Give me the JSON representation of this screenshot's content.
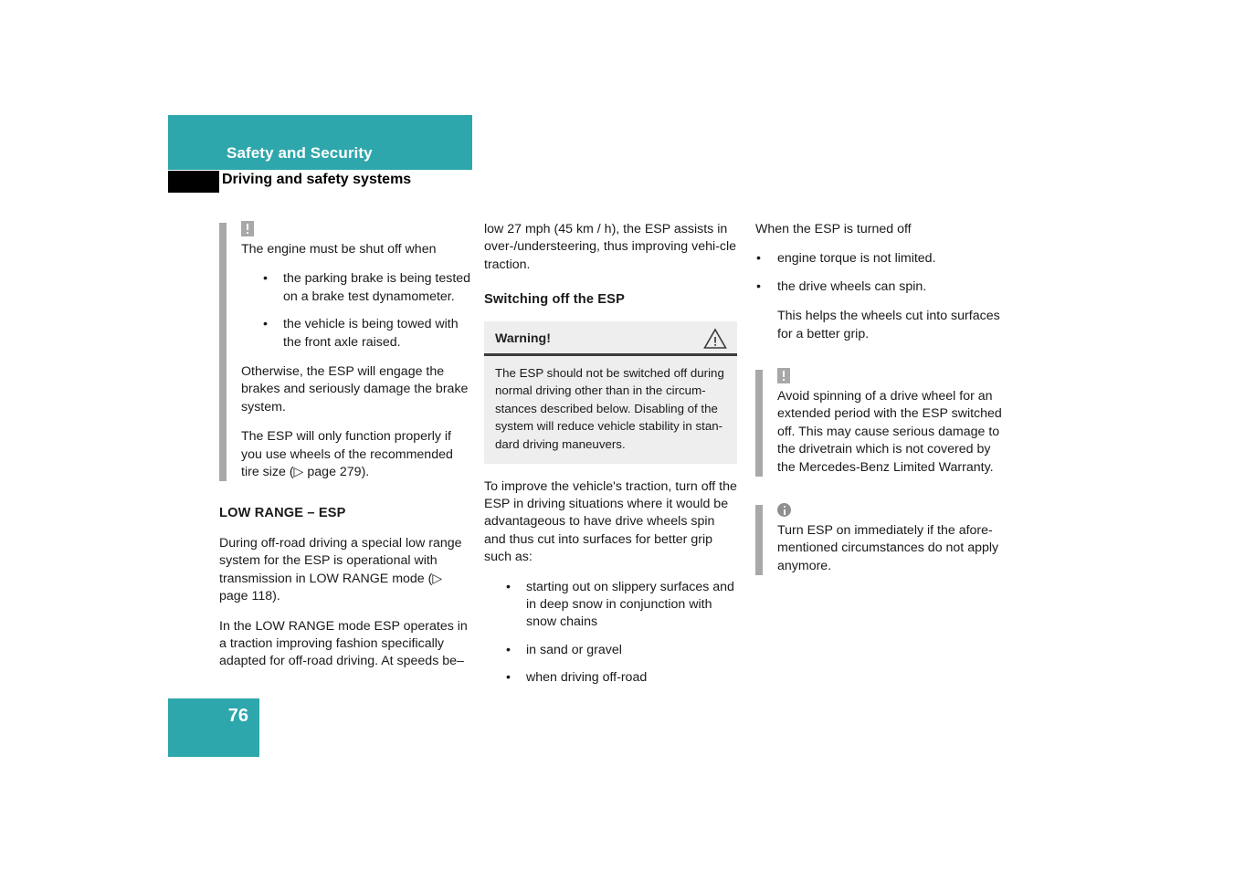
{
  "header": {
    "band_title": "Safety and Security",
    "sub_title": "Driving and safety systems"
  },
  "page_number": "76",
  "colors": {
    "accent_teal": "#2ea7ac",
    "note_bar_gray": "#a8a8a8",
    "warning_box_bg": "#eeeeee",
    "warning_rule": "#3c3c3c",
    "black_block": "#000000"
  },
  "icons": {
    "exclamation": "warning-exclamation-icon",
    "info": "info-circle-icon",
    "triangle": "warning-triangle-icon",
    "cross_ref_arrow": "triangle-right-arrow-icon"
  },
  "column1": {
    "note": {
      "icon": "!",
      "intro": "The engine must be shut off when",
      "bullets": [
        "the parking brake is being tested on a brake test dynamometer.",
        "the vehicle is being towed with the front axle raised."
      ],
      "para1": "Otherwise, the ESP will engage the brakes and seriously damage the brake system.",
      "para2": "The ESP will only function properly if you use wheels of the recommended tire size (▷ page 279)."
    },
    "section_title": "LOW RANGE – ESP",
    "para1": "During off-road driving a special low range system for the ESP is operational with transmission in LOW RANGE mode (▷ page 118).",
    "para2": "In the LOW RANGE mode ESP operates in a traction improving fashion specifically adapted for off-road driving. At speeds be–"
  },
  "column2": {
    "para_continued": "low 27 mph (45 km / h), the ESP assists in over-/understeering, thus improving vehi-cle traction.",
    "section_title": "Switching off the ESP",
    "warning_box": {
      "title": "Warning!",
      "body": "The ESP should not be switched off during normal driving other than in the circum-stances described below. Disabling of the system will reduce vehicle stability in stan-dard driving maneuvers."
    },
    "para_after": "To improve the vehicle's traction, turn off the ESP in driving situations where it would be advantageous to have drive wheels spin and thus cut into surfaces for better grip such as:",
    "bullets": [
      "starting out on slippery surfaces and in deep snow in conjunction with snow chains",
      "in sand or gravel",
      "when driving off-road"
    ]
  },
  "column3": {
    "intro": "When the ESP is turned off",
    "bullets": [
      "engine torque is not limited.",
      "the drive wheels can spin."
    ],
    "sub_note": "This helps the wheels cut into surfaces for a better grip.",
    "note_warning": {
      "icon": "!",
      "text": "Avoid spinning of a drive wheel for an extended period with the ESP switched off. This may cause serious damage to the drivetrain which is not covered by the Mercedes-Benz Limited Warranty."
    },
    "note_info": {
      "icon": "i",
      "text": "Turn ESP on immediately if the afore-mentioned circumstances do not apply anymore."
    }
  }
}
